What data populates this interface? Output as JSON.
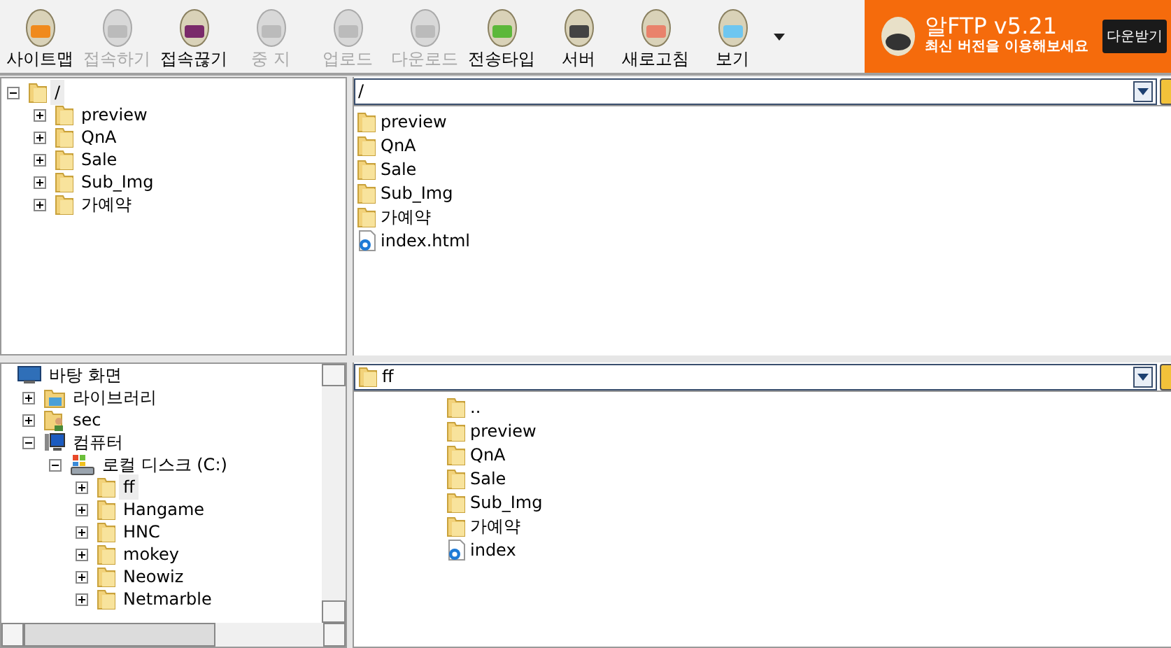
{
  "toolbar": {
    "buttons": [
      {
        "label": "사이트맵",
        "kind": "sitemap",
        "disabled": false
      },
      {
        "label": "접속하기",
        "kind": "connect",
        "disabled": true
      },
      {
        "label": "접속끊기",
        "kind": "disconnect",
        "disabled": false
      },
      {
        "label": "중 지",
        "kind": "stop",
        "disabled": true
      },
      {
        "label": "업로드",
        "kind": "upload",
        "disabled": true
      },
      {
        "label": "다운로드",
        "kind": "download",
        "disabled": true
      },
      {
        "label": "전송타입",
        "kind": "transfer",
        "disabled": false
      },
      {
        "label": "서버",
        "kind": "server",
        "disabled": false
      },
      {
        "label": "새로고침",
        "kind": "refresh",
        "disabled": false
      },
      {
        "label": "보기",
        "kind": "view",
        "disabled": false
      }
    ]
  },
  "banner": {
    "title": "알FTP v5.21",
    "subtitle": "최신 버전을 이용해보세요",
    "button": "다운받기"
  },
  "remote_tree": [
    {
      "label": "/",
      "kind": "folder",
      "expanded": true,
      "selected": true,
      "children": [
        {
          "label": "preview",
          "kind": "folder",
          "expanded": false,
          "selected": false
        },
        {
          "label": "QnA",
          "kind": "folder",
          "expanded": false,
          "selected": false
        },
        {
          "label": "Sale",
          "kind": "folder",
          "expanded": false,
          "selected": false
        },
        {
          "label": "Sub_Img",
          "kind": "folder",
          "expanded": false,
          "selected": false
        },
        {
          "label": "가예약",
          "kind": "folder",
          "expanded": false,
          "selected": false
        }
      ]
    }
  ],
  "remote_path": "/",
  "remote_files": [
    {
      "name": "preview",
      "kind": "folder"
    },
    {
      "name": "QnA",
      "kind": "folder"
    },
    {
      "name": "Sale",
      "kind": "folder"
    },
    {
      "name": "Sub_Img",
      "kind": "folder"
    },
    {
      "name": "가예약",
      "kind": "folder"
    },
    {
      "name": "index.html",
      "kind": "web"
    }
  ],
  "local_tree": [
    {
      "label": "바탕 화면",
      "kind": "desktop",
      "selected": false,
      "children": [
        {
          "label": "라이브러리",
          "kind": "library",
          "expanded": false,
          "selected": false
        },
        {
          "label": "sec",
          "kind": "user",
          "expanded": false,
          "selected": false
        },
        {
          "label": "컴퓨터",
          "kind": "computer",
          "expanded": true,
          "selected": false,
          "children": [
            {
              "label": "로컬 디스크 (C:)",
              "kind": "drive",
              "expanded": true,
              "selected": false,
              "children": [
                {
                  "label": "ff",
                  "kind": "folder",
                  "expanded": false,
                  "selected": true
                },
                {
                  "label": "Hangame",
                  "kind": "folder",
                  "expanded": false,
                  "selected": false
                },
                {
                  "label": "HNC",
                  "kind": "folder",
                  "expanded": false,
                  "selected": false
                },
                {
                  "label": "mokey",
                  "kind": "folder",
                  "expanded": false,
                  "selected": false
                },
                {
                  "label": "Neowiz",
                  "kind": "folder",
                  "expanded": false,
                  "selected": false
                },
                {
                  "label": "Netmarble",
                  "kind": "folder",
                  "expanded": false,
                  "selected": false
                }
              ]
            }
          ]
        }
      ]
    }
  ],
  "local_path": "ff",
  "local_files": [
    {
      "name": "..",
      "kind": "folder"
    },
    {
      "name": "preview",
      "kind": "folder"
    },
    {
      "name": "QnA",
      "kind": "folder"
    },
    {
      "name": "Sale",
      "kind": "folder"
    },
    {
      "name": "Sub_Img",
      "kind": "folder"
    },
    {
      "name": "가예약",
      "kind": "folder"
    },
    {
      "name": "index",
      "kind": "web"
    }
  ]
}
